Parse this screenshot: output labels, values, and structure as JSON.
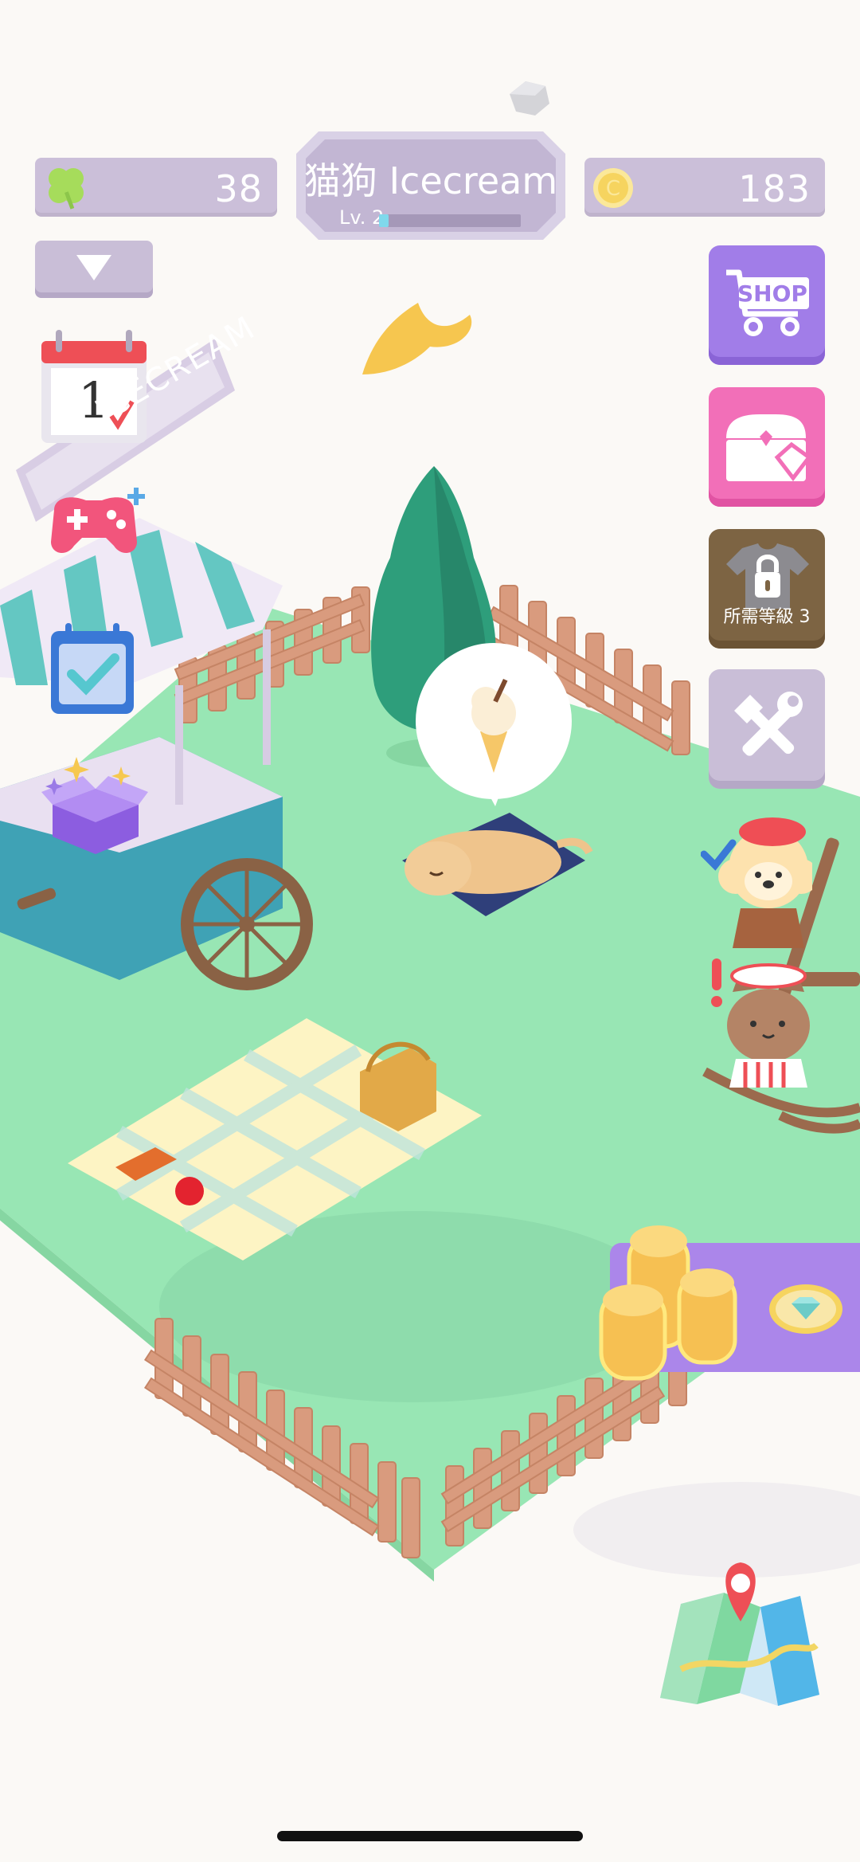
{
  "hud": {
    "clover_count": "38",
    "coin_count": "183",
    "shop_title": "猫狗 Icecream",
    "level_label": "Lv. 2",
    "xp_progress": 0.07
  },
  "calendar": {
    "day": "1"
  },
  "sign": {
    "text": "ICECREAM"
  },
  "side_buttons": {
    "shop_label": "SHOP",
    "locked_label": "所需等級 3"
  },
  "colors": {
    "grass": "#98e6b4",
    "panel_purple": "#cbbfd9",
    "shop_purple": "#a17de8",
    "chest_pink": "#f26fb8",
    "locked_brown": "#7d6443",
    "fence": "#d99b7e",
    "background": "#fbf9f6"
  },
  "icons": [
    "clover-icon",
    "coin-icon",
    "dropdown-icon",
    "calendar-icon",
    "gamepad-icon",
    "checklist-icon",
    "gift-box-icon",
    "shop-cart-icon",
    "chest-gem-icon",
    "shirt-lock-icon",
    "tools-icon",
    "map-icon",
    "coin-stack-icon",
    "gem-icon",
    "ice-cream-icon"
  ]
}
